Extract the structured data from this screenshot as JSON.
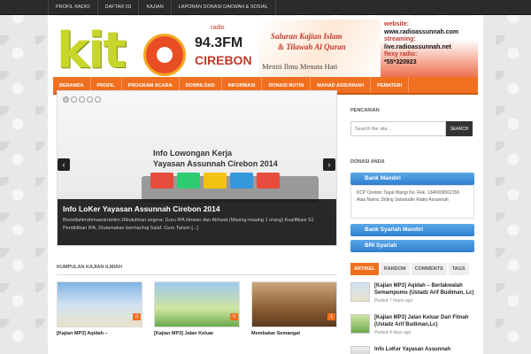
{
  "topnav": [
    "PROFIL RADIO",
    "DAFTAR ISI",
    "KAJIAN",
    "LAPORAN DONASI DAKWAH & SOSIAL"
  ],
  "logo": {
    "text": "kit",
    "radio": "radio",
    "freq": "94.3FM",
    "city": "CIREBON"
  },
  "banner": {
    "line1": "Saluran Kajian Islam",
    "line2": "& Tilawah Al Quran",
    "tagline": "Meniti Ilmu Menata Hati"
  },
  "contact": {
    "website_label": "website:",
    "website": "www.radioassunnah.com",
    "streaming_label": "streaming:",
    "streaming": "live.radioassunnah.net",
    "flexy_label": "flexy radio:",
    "flexy": "*55*320923"
  },
  "mainnav": [
    "BERANDA",
    "PROFIL",
    "PROGRAM ACARA",
    "DOWNLOAD",
    "INFORMASI",
    "DONASI RUTIN",
    "MAHAD ASSUNNAH",
    "PEMATERI"
  ],
  "slider": {
    "dots": [
      true,
      false,
      false,
      false,
      false
    ],
    "image_title1": "Info Lowongan Kerja",
    "image_title2": "Yayasan Assunnah Cirebon 2014",
    "caption_title": "Info LoKer Yayasan Assunnah Cirebon 2014",
    "caption_text": "Bismillahirrahmaanirrahiim Dibutuhkan segera: Guru IPA Ikhwan dan Akhwat (Masing-masing 1 orang) Kualifikasi S1 Pendidikan IPA, Diutamakan bermanhaj Salaf. Guru Tahsin [...]",
    "prev": "‹",
    "next": "›"
  },
  "kajian": {
    "heading": "KUMPULAN KAJIAN ILMIAH",
    "cards": [
      {
        "title": "[Kajian MP3] Aqidah –",
        "count": "0"
      },
      {
        "title": "[Kajian MP3] Jalan Keluar",
        "count": "0"
      },
      {
        "title": "Membakar Semangat",
        "count": "1"
      }
    ]
  },
  "sidebar": {
    "search_heading": "PENCARIAN",
    "search_placeholder": "Search the site...",
    "search_button": "SEARCH",
    "donasi_heading": "DONASI ANDA",
    "bank1": "Bank Mandiri",
    "bank1_detail": "KCP Cirebon Tegal Wangi No. Rek. 1340006502156 Atas Nama: Diding Sobarudin Radio Assunnah",
    "bank2": "Bank Syariah Mandiri",
    "bank3": "BRI Syariah",
    "tabs": [
      "ARTIKEL",
      "RANDOM",
      "COMMENTS",
      "TAGS"
    ],
    "posts": [
      {
        "title": "[Kajian MP3] Aqidah – Bertakwalah Semampumu (Ustadz Arif Budiman, Lc)",
        "date": "Posted 7 hours ago"
      },
      {
        "title": "[Kajian MP3] Jalan Keluar Dari Fitnah (Ustadz Arif Budiman,Lc)",
        "date": "Posted 4 days ago"
      },
      {
        "title": "Info LoKer Yayasan Assunnah",
        "date": ""
      }
    ]
  }
}
